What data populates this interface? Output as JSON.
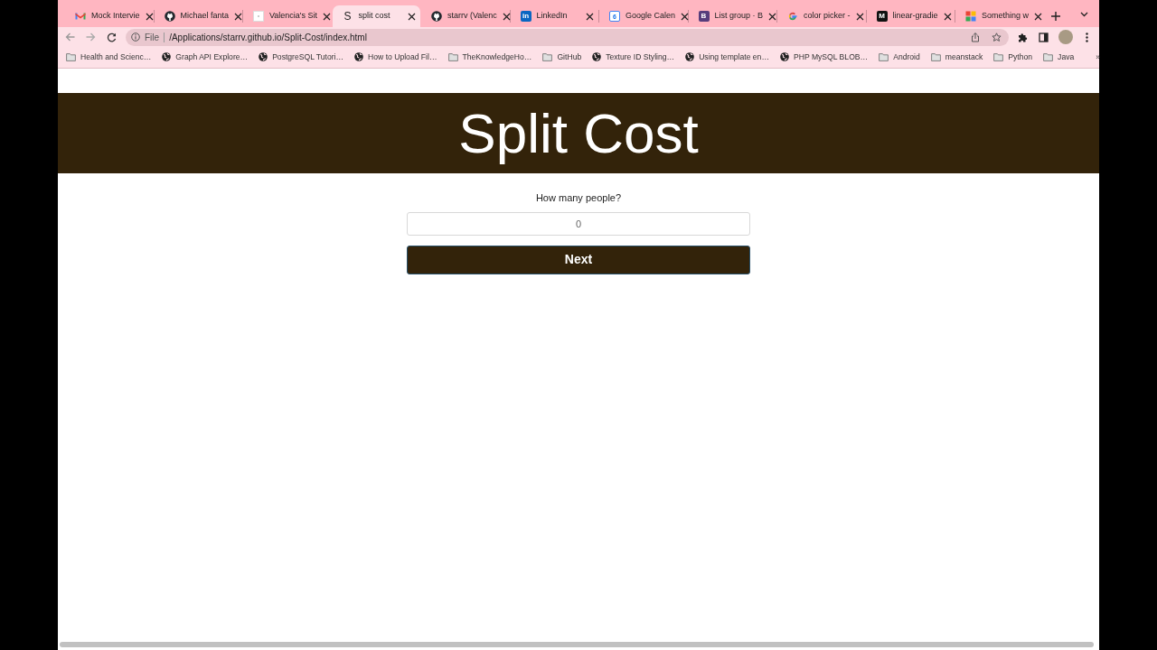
{
  "tabs": [
    {
      "title": "Mock Intervie",
      "kind": "gmail",
      "selected": false
    },
    {
      "title": "Michael fanta",
      "kind": "github",
      "selected": false
    },
    {
      "title": "Valencia's Sit",
      "kind": "blank",
      "selected": false
    },
    {
      "title": "split cost",
      "kind": "letter",
      "glyph": "S",
      "selected": true
    },
    {
      "title": "starrv (Valenc",
      "kind": "github",
      "selected": false
    },
    {
      "title": "LinkedIn",
      "kind": "linkedin",
      "glyph": "in",
      "selected": false
    },
    {
      "title": "Google Calen",
      "kind": "calendar",
      "glyph": "6",
      "selected": false
    },
    {
      "title": "List group · B",
      "kind": "bootstrap",
      "glyph": "B",
      "selected": false
    },
    {
      "title": "color picker -",
      "kind": "google",
      "selected": false
    },
    {
      "title": "linear-gradie",
      "kind": "medium",
      "glyph": "M",
      "selected": false
    },
    {
      "title": "Something w",
      "kind": "pinwheel",
      "selected": false
    }
  ],
  "address_bar": {
    "scheme_label": "File",
    "url": "/Applications/starrv.github.io/Split-Cost/index.html"
  },
  "bookmarks": [
    {
      "label": "Health and Scienc…",
      "kind": "folder"
    },
    {
      "label": "Graph API Explore…",
      "kind": "site"
    },
    {
      "label": "PostgreSQL Tutori…",
      "kind": "site"
    },
    {
      "label": "How to Upload Fil…",
      "kind": "site"
    },
    {
      "label": "TheKnowledgeHo…",
      "kind": "folder"
    },
    {
      "label": "GitHub",
      "kind": "folder"
    },
    {
      "label": "Texture ID Styling…",
      "kind": "site"
    },
    {
      "label": "Using template en…",
      "kind": "site"
    },
    {
      "label": "PHP MySQL BLOB…",
      "kind": "site"
    },
    {
      "label": "Android",
      "kind": "folder"
    },
    {
      "label": "meanstack",
      "kind": "folder"
    },
    {
      "label": "Python",
      "kind": "folder"
    },
    {
      "label": "Java",
      "kind": "folder"
    }
  ],
  "bookmarks_overflow": "»",
  "page": {
    "title": "Split Cost",
    "prompt": "How many people?",
    "people_field": {
      "placeholder": "0"
    },
    "next_button": "Next"
  }
}
